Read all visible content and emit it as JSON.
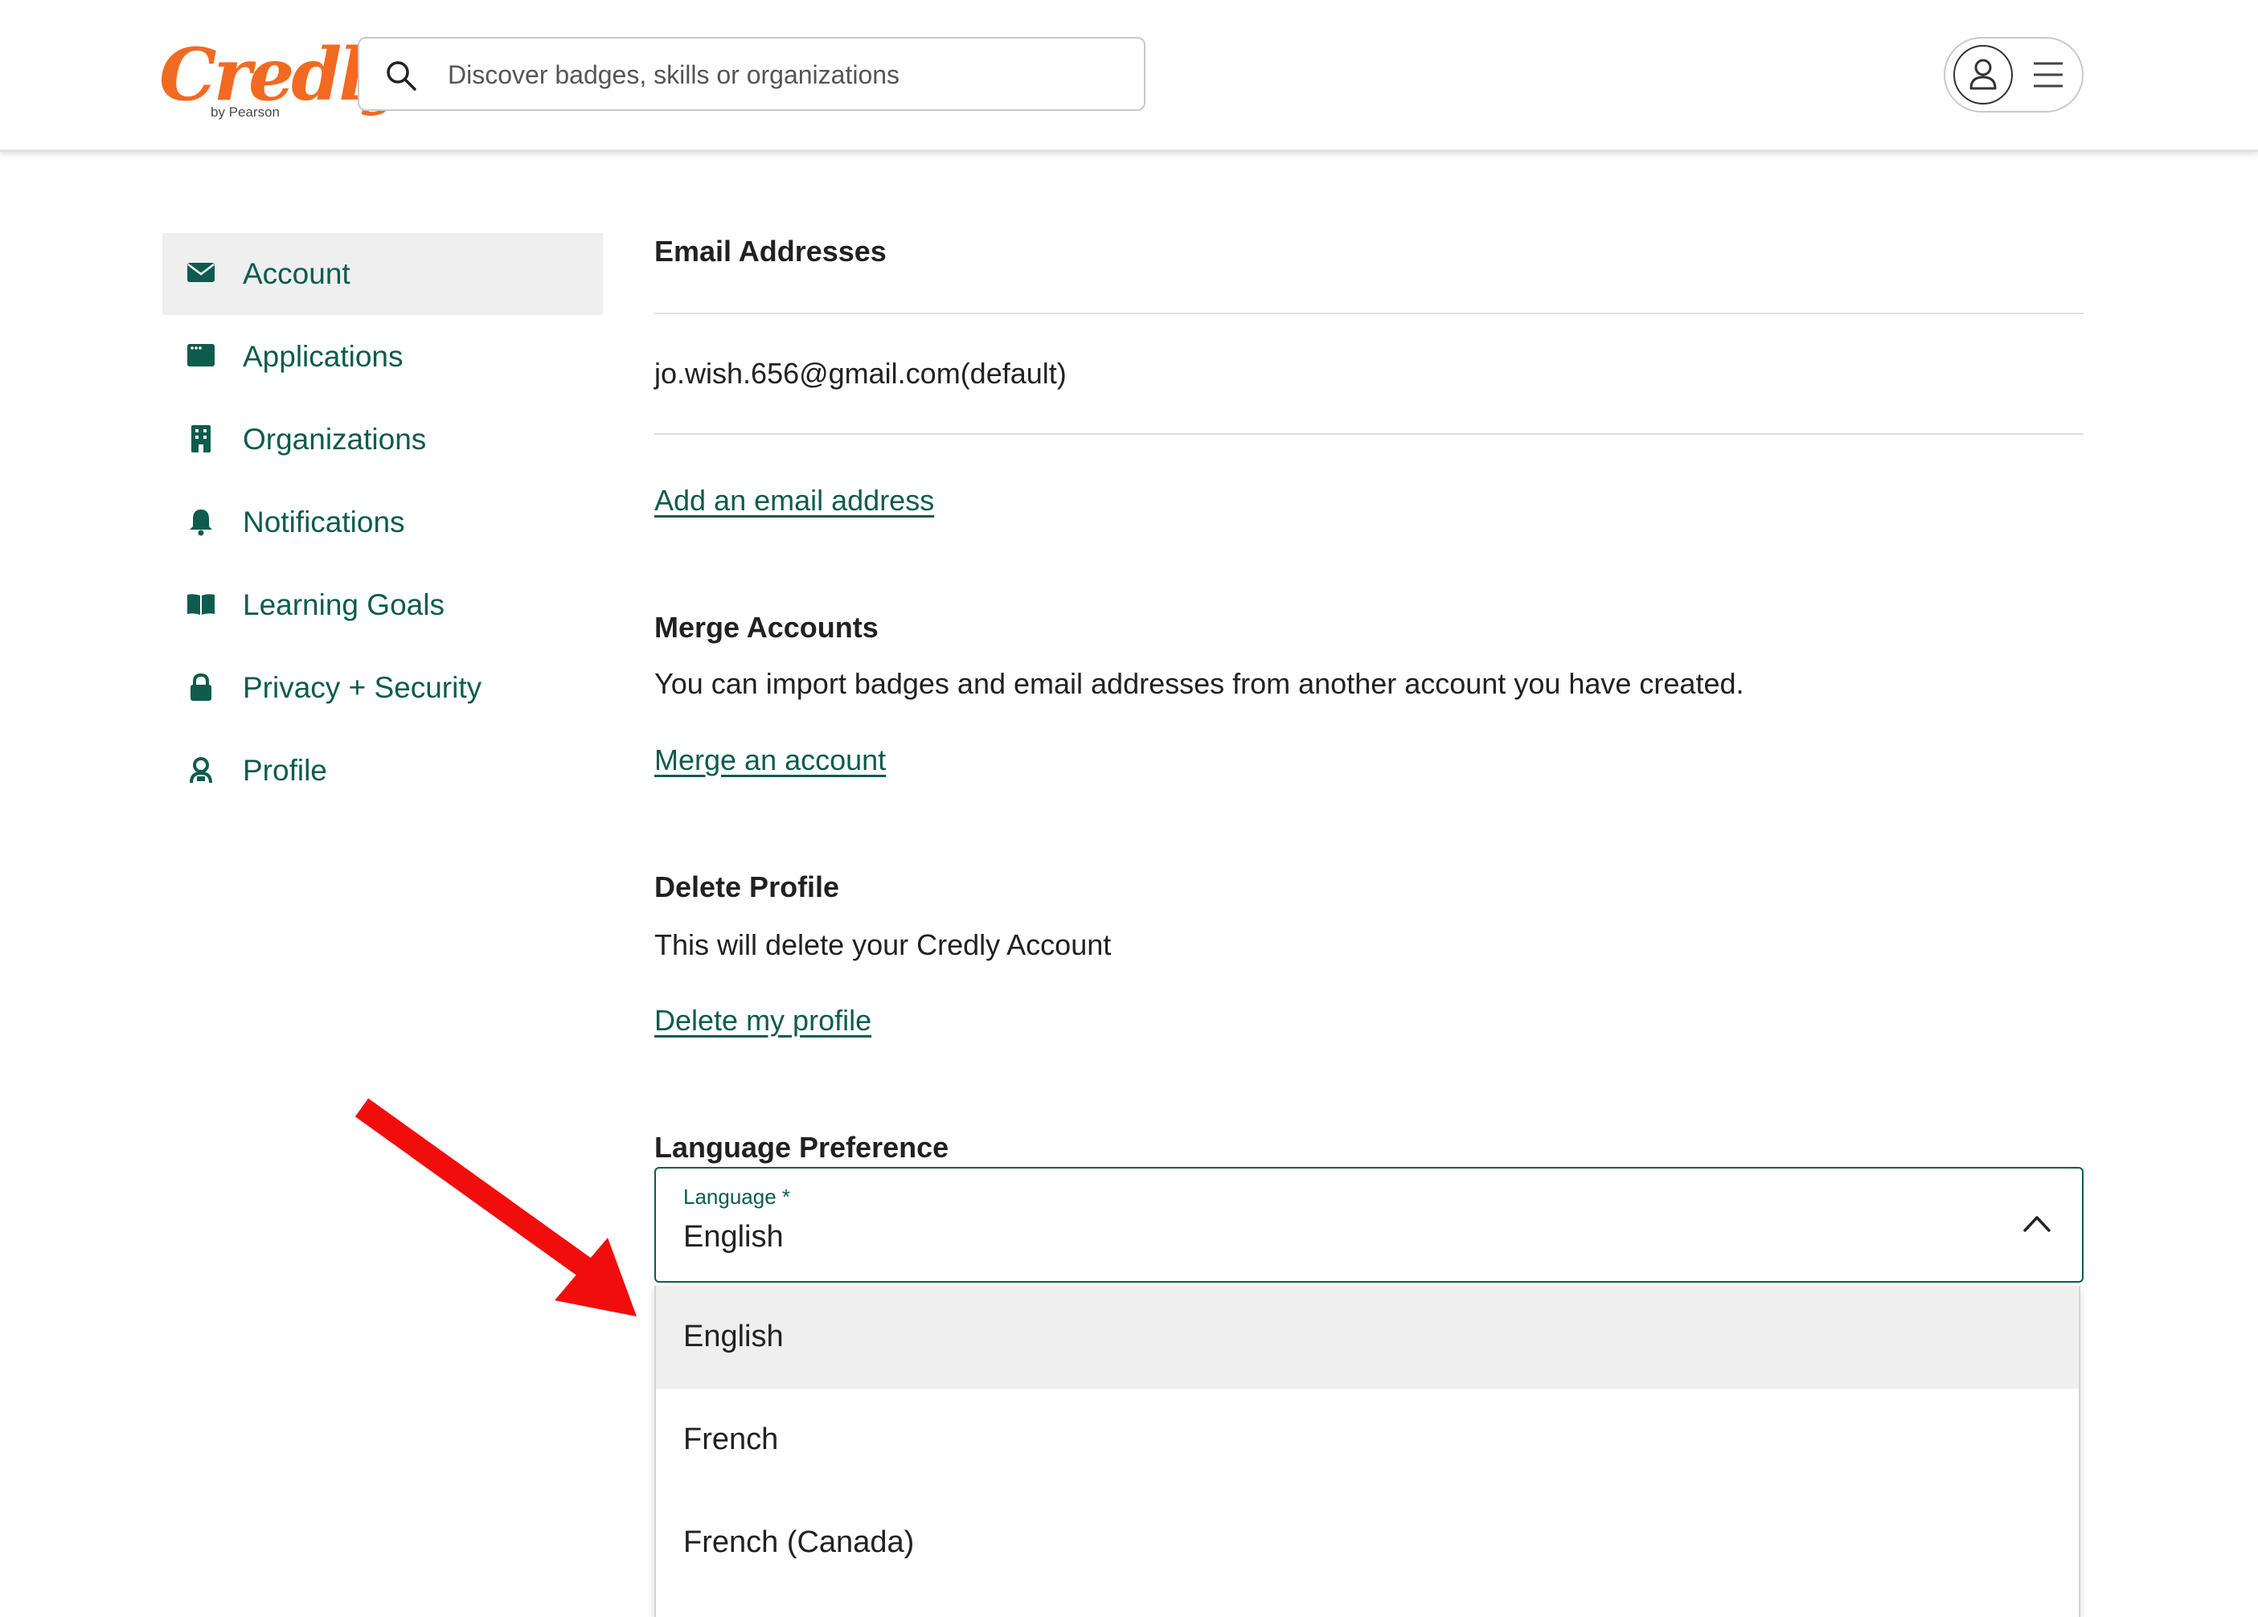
{
  "header": {
    "logo_text": "Credly",
    "logo_subtext": "by Pearson",
    "search_placeholder": "Discover badges, skills or organizations",
    "search_value": ""
  },
  "sidebar": {
    "items": [
      {
        "label": "Account",
        "icon": "envelope-icon",
        "active": true
      },
      {
        "label": "Applications",
        "icon": "app-window-icon",
        "active": false
      },
      {
        "label": "Organizations",
        "icon": "building-icon",
        "active": false
      },
      {
        "label": "Notifications",
        "icon": "bell-icon",
        "active": false
      },
      {
        "label": "Learning Goals",
        "icon": "open-book-icon",
        "active": false
      },
      {
        "label": "Privacy + Security",
        "icon": "lock-icon",
        "active": false
      },
      {
        "label": "Profile",
        "icon": "person-badge-icon",
        "active": false
      }
    ]
  },
  "email": {
    "title": "Email Addresses",
    "address": "jo.wish.656@gmail.com(default)",
    "add_link": "Add an email address"
  },
  "merge": {
    "title": "Merge Accounts",
    "description": "You can import badges and email addresses from another account you have created.",
    "link": "Merge an account"
  },
  "delete": {
    "title": "Delete Profile",
    "description": "This will delete your Credly Account",
    "link": "Delete my profile"
  },
  "language": {
    "title": "Language Preference",
    "field_label": "Language *",
    "selected": "English",
    "options": [
      "English",
      "French",
      "French (Canada)"
    ]
  },
  "colors": {
    "brand": "#f26a21",
    "accent": "#0d5c4d",
    "annotation_arrow": "#f20d0d"
  }
}
